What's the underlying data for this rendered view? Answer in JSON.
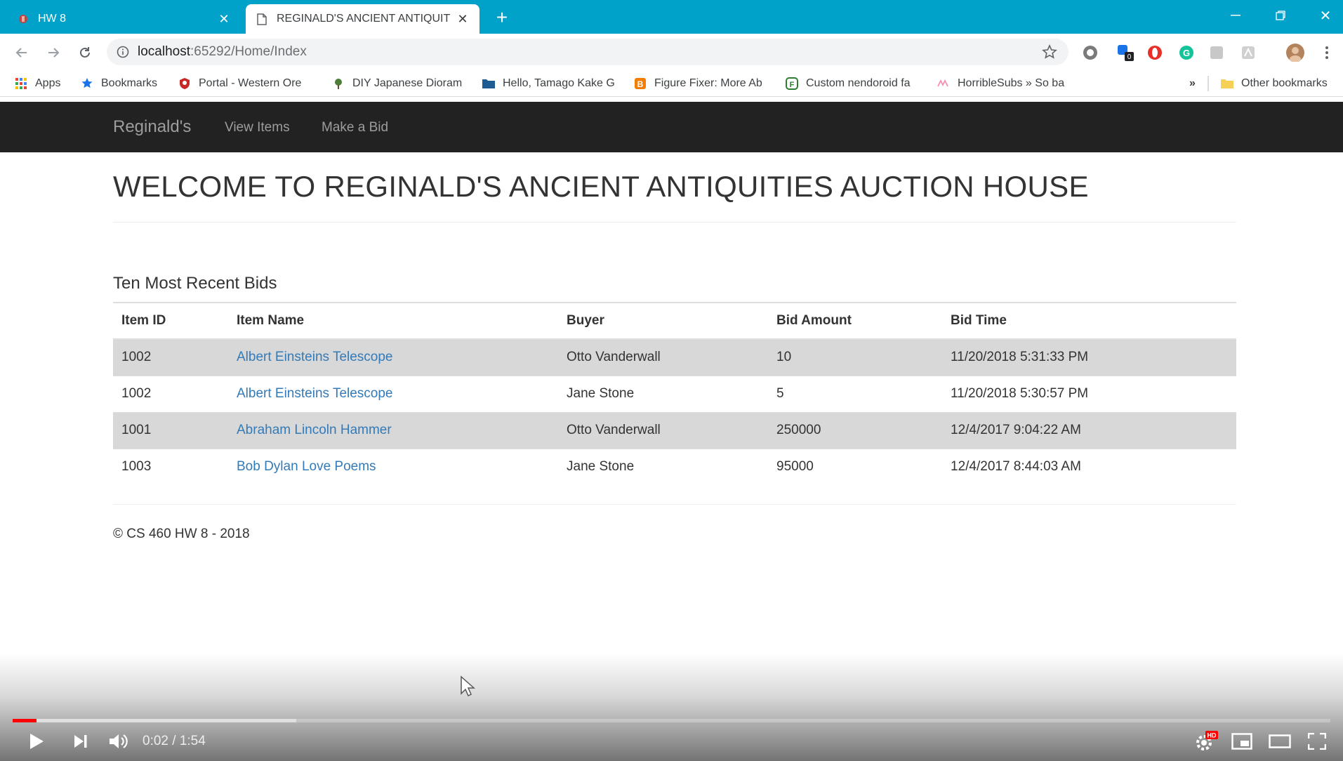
{
  "browser": {
    "tabs": [
      {
        "title": "HW 8",
        "active": false
      },
      {
        "title": "REGINALD'S ANCIENT ANTIQUIT",
        "active": true
      }
    ],
    "url_host": "localhost",
    "url_rest": ":65292/Home/Index",
    "bookmarks": [
      {
        "label": "Apps",
        "icon": "apps-grid-icon"
      },
      {
        "label": "Bookmarks",
        "icon": "star-icon"
      },
      {
        "label": "Portal - Western Ore",
        "icon": "shield-icon"
      },
      {
        "label": "DIY Japanese Dioram",
        "icon": "tree-icon"
      },
      {
        "label": "Hello, Tamago Kake G",
        "icon": "folder-icon"
      },
      {
        "label": "Figure Fixer: More Ab",
        "icon": "blogger-icon"
      },
      {
        "label": "Custom nendoroid fa",
        "icon": "fb-icon"
      },
      {
        "label": "HorribleSubs » So ba",
        "icon": "hs-icon"
      }
    ],
    "bookmarks_overflow": "»",
    "other_bookmarks": "Other bookmarks",
    "extension_badge": "0"
  },
  "site": {
    "brand": "Reginald's",
    "nav": [
      "View Items",
      "Make a Bid"
    ],
    "title": "WELCOME TO REGINALD'S ANCIENT ANTIQUITIES AUCTION HOUSE",
    "section_title": "Ten Most Recent Bids",
    "table": {
      "headers": [
        "Item ID",
        "Item Name",
        "Buyer",
        "Bid Amount",
        "Bid Time"
      ],
      "rows": [
        {
          "item_id": "1002",
          "item_name": "Albert Einsteins Telescope",
          "buyer": "Otto Vanderwall",
          "bid_amount": "10",
          "bid_time": "11/20/2018 5:31:33 PM"
        },
        {
          "item_id": "1002",
          "item_name": "Albert Einsteins Telescope",
          "buyer": "Jane Stone",
          "bid_amount": "5",
          "bid_time": "11/20/2018 5:30:57 PM"
        },
        {
          "item_id": "1001",
          "item_name": "Abraham Lincoln Hammer",
          "buyer": "Otto Vanderwall",
          "bid_amount": "250000",
          "bid_time": "12/4/2017 9:04:22 AM"
        },
        {
          "item_id": "1003",
          "item_name": "Bob Dylan Love Poems",
          "buyer": "Jane Stone",
          "bid_amount": "95000",
          "bid_time": "12/4/2017 8:44:03 AM"
        }
      ]
    },
    "footer": "© CS 460 HW 8 - 2018"
  },
  "video": {
    "time_display": "0:02 / 1:54",
    "played_fraction": 0.018,
    "buffered_fraction": 0.215,
    "quality_badge": "HD"
  },
  "colors": {
    "tab_bar": "#00a2c9",
    "navbar": "#222222",
    "link": "#337ab7",
    "striped_row": "#d9d8d9",
    "progress": "#ff0000"
  }
}
